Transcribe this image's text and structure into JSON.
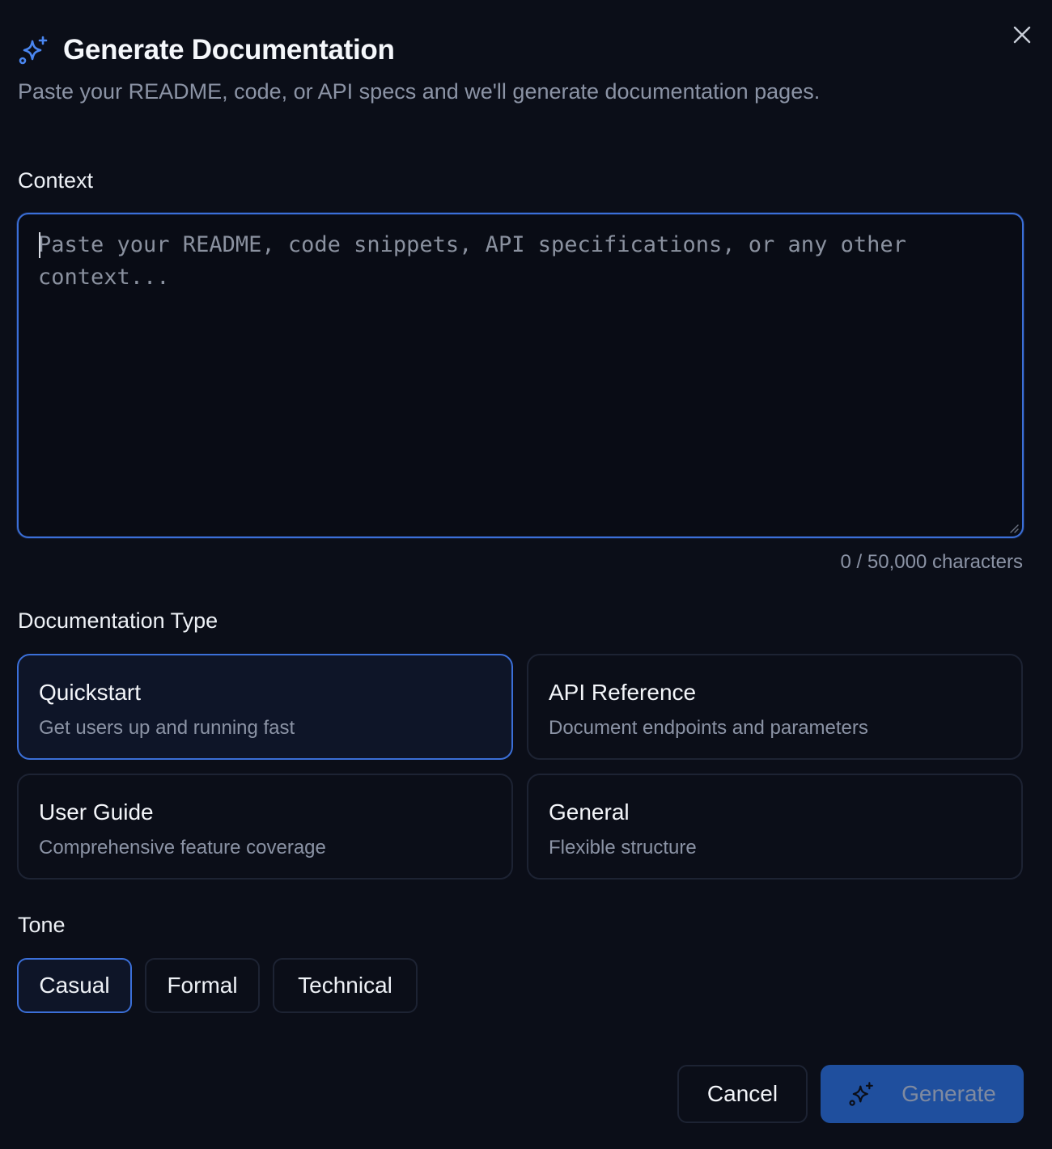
{
  "dialog": {
    "title": "Generate Documentation",
    "subtitle": "Paste your README, code, or API specs and we'll generate documentation pages.",
    "title_icon": "sparkles-icon",
    "close_icon": "close-icon"
  },
  "context": {
    "label": "Context",
    "value": "",
    "placeholder": "Paste your README, code snippets, API specifications, or any other context...",
    "char_count": "0 / 50,000 characters"
  },
  "doc_type": {
    "label": "Documentation Type",
    "selected": "Quickstart",
    "options": [
      {
        "title": "Quickstart",
        "description": "Get users up and running fast"
      },
      {
        "title": "API Reference",
        "description": "Document endpoints and parameters"
      },
      {
        "title": "User Guide",
        "description": "Comprehensive feature coverage"
      },
      {
        "title": "General",
        "description": "Flexible structure"
      }
    ]
  },
  "tone": {
    "label": "Tone",
    "selected": "Casual",
    "options": [
      "Casual",
      "Formal",
      "Technical"
    ]
  },
  "footer": {
    "cancel_label": "Cancel",
    "generate_label": "Generate",
    "generate_icon": "sparkles-icon"
  },
  "colors": {
    "background": "#0b0e18",
    "accent": "#3b6fd8",
    "generate_button": "#1f4f9e",
    "muted_text": "#8b93a5"
  }
}
